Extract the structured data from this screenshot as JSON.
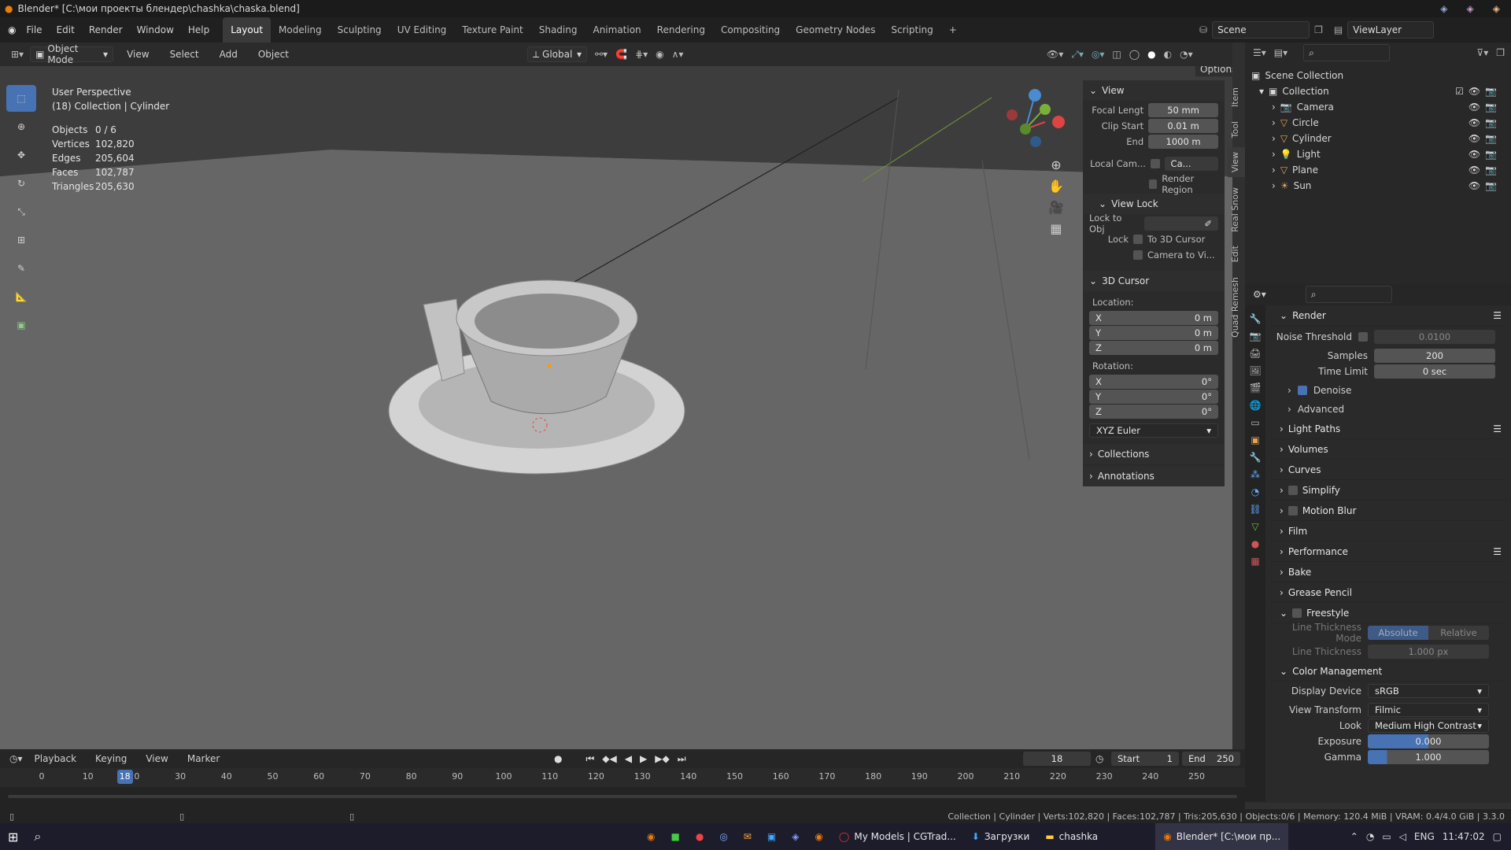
{
  "title_bar": {
    "text": "Blender* [C:\\мои проекты блендер\\chashka\\chaska.blend]"
  },
  "menu": [
    "File",
    "Edit",
    "Render",
    "Window",
    "Help"
  ],
  "workspaces": [
    "Layout",
    "Modeling",
    "Sculpting",
    "UV Editing",
    "Texture Paint",
    "Shading",
    "Animation",
    "Rendering",
    "Compositing",
    "Geometry Nodes",
    "Scripting",
    "+"
  ],
  "active_workspace": "Layout",
  "scene": "Scene",
  "view_layer": "ViewLayer",
  "viewport_header": {
    "mode": "Object Mode",
    "menus": [
      "View",
      "Select",
      "Add",
      "Object"
    ],
    "orientation": "Global",
    "options": "Options"
  },
  "overlay_text": {
    "perspective": "User Perspective",
    "collection": "(18) Collection | Cylinder",
    "stats": [
      {
        "label": "Objects",
        "value": "0 / 6"
      },
      {
        "label": "Vertices",
        "value": "102,820"
      },
      {
        "label": "Edges",
        "value": "205,604"
      },
      {
        "label": "Faces",
        "value": "102,787"
      },
      {
        "label": "Triangles",
        "value": "205,630"
      }
    ]
  },
  "npanel": {
    "view_title": "View",
    "focal_label": "Focal Lengt",
    "focal_value": "50 mm",
    "clip_start_label": "Clip Start",
    "clip_start_value": "0.01 m",
    "clip_end_label": "End",
    "clip_end_value": "1000 m",
    "local_cam_label": "Local Cam...",
    "local_cam_value": "Ca...",
    "render_region": "Render Region",
    "view_lock_title": "View Lock",
    "lock_to_obj": "Lock to Obj",
    "lock_label": "Lock",
    "to_3d_cursor": "To 3D Cursor",
    "camera_to_view": "Camera to Vi...",
    "cursor_title": "3D Cursor",
    "location_label": "Location:",
    "rotation_label": "Rotation:",
    "loc": [
      {
        "axis": "X",
        "value": "0 m"
      },
      {
        "axis": "Y",
        "value": "0 m"
      },
      {
        "axis": "Z",
        "value": "0 m"
      }
    ],
    "rot": [
      {
        "axis": "X",
        "value": "0°"
      },
      {
        "axis": "Y",
        "value": "0°"
      },
      {
        "axis": "Z",
        "value": "0°"
      }
    ],
    "rot_mode": "XYZ Euler",
    "collections": "Collections",
    "annotations": "Annotations"
  },
  "side_tabs": [
    "Item",
    "Tool",
    "View",
    "Real Snow",
    "Edit",
    "Quad Remesh"
  ],
  "outliner": {
    "root": "Scene Collection",
    "collection": "Collection",
    "items": [
      "Camera",
      "Circle",
      "Cylinder",
      "Light",
      "Plane",
      "Sun"
    ]
  },
  "properties": {
    "render_title": "Render",
    "noise_threshold_label": "Noise Threshold",
    "noise_threshold_value": "0.0100",
    "samples_label": "Samples",
    "samples_value": "200",
    "time_limit_label": "Time Limit",
    "time_limit_value": "0 sec",
    "denoise": "Denoise",
    "advanced": "Advanced",
    "sections": [
      "Light Paths",
      "Volumes",
      "Curves",
      "Simplify",
      "Motion Blur",
      "Film",
      "Performance",
      "Bake",
      "Grease Pencil",
      "Freestyle"
    ],
    "line_thickness_mode_label": "Line Thickness Mode",
    "absolute": "Absolute",
    "relative": "Relative",
    "line_thickness_label": "Line Thickness",
    "line_thickness_value": "1.000 px",
    "color_mgmt": "Color Management",
    "display_device_label": "Display Device",
    "display_device_value": "sRGB",
    "view_transform_label": "View Transform",
    "view_transform_value": "Filmic",
    "look_label": "Look",
    "look_value": "Medium High Contrast",
    "exposure_label": "Exposure",
    "exposure_value": "0.000",
    "gamma_label": "Gamma",
    "gamma_value": "1.000"
  },
  "timeline": {
    "menus": [
      "Playback",
      "Keying",
      "View",
      "Marker"
    ],
    "current_frame": "18",
    "start_label": "Start",
    "start": "1",
    "end_label": "End",
    "end": "250",
    "ticks": [
      "0",
      "10",
      "20",
      "30",
      "40",
      "50",
      "60",
      "70",
      "80",
      "90",
      "100",
      "110",
      "120",
      "130",
      "140",
      "150",
      "160",
      "170",
      "180",
      "190",
      "200",
      "210",
      "220",
      "230",
      "240",
      "250"
    ]
  },
  "status_bar": "Collection | Cylinder | Verts:102,820 | Faces:102,787 | Tris:205,630 | Objects:0/6 | Memory: 120.4 MiB | VRAM: 0.4/4.0 GiB | 3.3.0",
  "taskbar": {
    "items": [
      "My Models | CGTrad...",
      "Загрузки",
      "chashka",
      "Blender* [C:\\мои пр..."
    ],
    "lang": "ENG",
    "time": "11:47:02"
  }
}
